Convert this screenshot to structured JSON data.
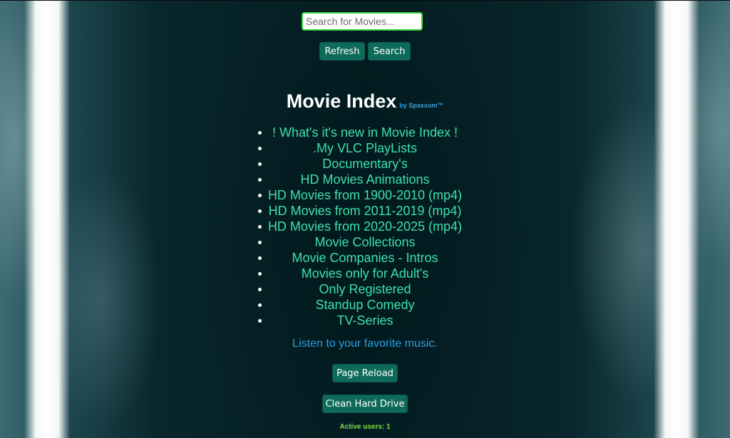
{
  "search": {
    "placeholder": "Search for Movies...",
    "value": ""
  },
  "toolbar": {
    "refresh_label": "Refresh",
    "search_label": "Search"
  },
  "header": {
    "title": "Movie Index",
    "byline": "by Spaxsum™"
  },
  "menu": {
    "items": [
      {
        "label": "! What's it's new in Movie Index !"
      },
      {
        "label": ".My VLC PlayLists"
      },
      {
        "label": "Documentary's"
      },
      {
        "label": "HD Movies Animations"
      },
      {
        "label": "HD Movies from 1900-2010 (mp4)"
      },
      {
        "label": "HD Movies from 2011-2019 (mp4)"
      },
      {
        "label": "HD Movies from 2020-2025 (mp4)"
      },
      {
        "label": "Movie Collections"
      },
      {
        "label": "Movie Companies - Intros"
      },
      {
        "label": "Movies only for Adult's"
      },
      {
        "label": "Only Registered"
      },
      {
        "label": "Standup Comedy"
      },
      {
        "label": "TV-Series"
      }
    ]
  },
  "music": {
    "link_label": "Listen to your favorite music."
  },
  "actions": {
    "page_reload_label": "Page Reload",
    "clean_drive_label": "Clean Hard Drive"
  },
  "footer": {
    "active_users": "Active users: 1"
  },
  "colors": {
    "accent_button": "#0e6a5a",
    "menu_text": "#3fe0a8",
    "link_blue": "#2e9fe0",
    "search_border": "#35d43d",
    "active_users": "#7be04a"
  }
}
